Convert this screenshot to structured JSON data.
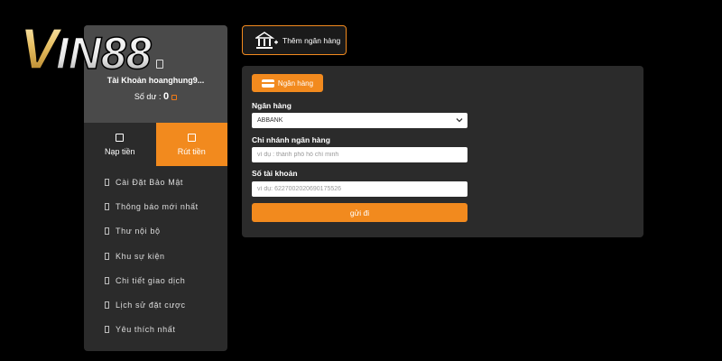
{
  "logo": {
    "text": "VIN88"
  },
  "account": {
    "name": "Tài Khoản hoanghung9...",
    "balance_label": "Số dư : ",
    "balance_value": "0"
  },
  "tabs": {
    "deposit": "Nạp tiền",
    "withdraw": "Rút tiền"
  },
  "menu": {
    "items": [
      {
        "label": "Cài Đặt Bảo Mật"
      },
      {
        "label": "Thông báo mới nhất"
      },
      {
        "label": "Thư nội bộ"
      },
      {
        "label": "Khu sự kiện"
      },
      {
        "label": "Chi tiết giao dịch"
      },
      {
        "label": "Lịch sử đặt cược"
      },
      {
        "label": "Yêu thích nhất"
      }
    ]
  },
  "add_bank": {
    "label": "Thêm ngân hàng"
  },
  "form": {
    "pill_label": "Ngân hàng",
    "bank_label": "Ngân hàng",
    "bank_value": "ABBANK",
    "branch_label": "Chi nhánh ngân hàng",
    "branch_placeholder": "ví dụ : thành phố hồ chí minh",
    "account_label": "Số tài khoản",
    "account_placeholder": "ví dụ: 6227002020690175526",
    "submit_label": "gửi đi"
  },
  "colors": {
    "accent": "#f28a1e",
    "panel": "#2b2b2b",
    "background": "#000000"
  },
  "icons": [
    "bank-plus-icon",
    "card-icon",
    "chevron-down-icon",
    "menu-bullet-icon"
  ]
}
